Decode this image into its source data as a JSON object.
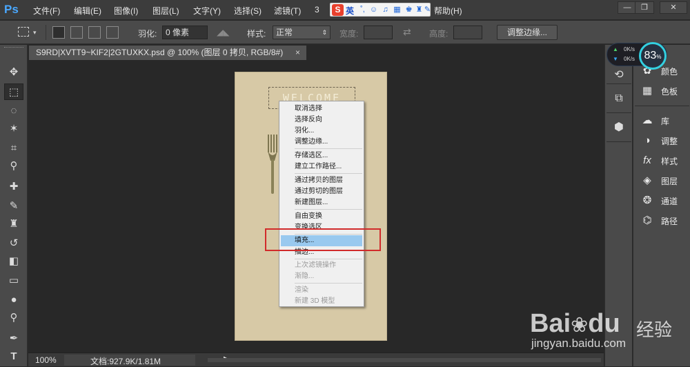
{
  "menubar": {
    "logo": "Ps",
    "items": [
      "文件(F)",
      "编辑(E)",
      "图像(I)",
      "图层(L)",
      "文字(Y)",
      "选择(S)",
      "滤镜(T)",
      "3",
      "帮助(H)"
    ],
    "ime": {
      "logo": "S",
      "lang": "英"
    }
  },
  "options": {
    "feather_label": "羽化:",
    "feather_value": "0 像素",
    "style_label": "样式:",
    "style_value": "正常",
    "width_label": "宽度:",
    "height_label": "高度:",
    "refine_edge": "调整边缘..."
  },
  "document_tab": {
    "title": "S9RD|XVTT9~KIF2|2GTUXKX.psd @ 100% (图层 0 拷贝, RGB/8#)",
    "close": "×"
  },
  "canvas": {
    "welcome_text": "WELCOME",
    "bg_color": "#d7c9a6"
  },
  "context_menu": {
    "items": [
      {
        "label": "取消选择",
        "disabled": false
      },
      {
        "label": "选择反向",
        "disabled": false
      },
      {
        "label": "羽化...",
        "disabled": false
      },
      {
        "label": "调整边缘...",
        "disabled": false
      },
      {
        "label": "存储选区...",
        "disabled": false
      },
      {
        "label": "建立工作路径...",
        "disabled": false
      },
      {
        "label": "通过拷贝的图层",
        "disabled": false
      },
      {
        "label": "通过剪切的图层",
        "disabled": false
      },
      {
        "label": "新建图层...",
        "disabled": false
      },
      {
        "label": "自由变换",
        "disabled": false
      },
      {
        "label": "变换选区",
        "disabled": false
      },
      {
        "label": "填充...",
        "disabled": false,
        "highlighted": true
      },
      {
        "label": "描边...",
        "disabled": false
      },
      {
        "label": "上次滤镜操作",
        "disabled": true
      },
      {
        "label": "渐隐...",
        "disabled": true
      },
      {
        "label": "渲染",
        "disabled": true
      },
      {
        "label": "新建 3D 模型",
        "disabled": true
      }
    ]
  },
  "statusbar": {
    "zoom": "100%",
    "doc_size": "文档:927.9K/1.81M",
    "arrow": "▶"
  },
  "panels": [
    {
      "icon": "palette-icon",
      "label": "颜色"
    },
    {
      "icon": "swatches-icon",
      "label": "色板"
    },
    {
      "icon": "library-icon",
      "label": "库"
    },
    {
      "icon": "adjustments-icon",
      "label": "调整"
    },
    {
      "icon": "styles-icon",
      "label": "样式"
    },
    {
      "icon": "layers-icon",
      "label": "图层"
    },
    {
      "icon": "channels-icon",
      "label": "通道"
    },
    {
      "icon": "paths-icon",
      "label": "路径"
    }
  ],
  "net_widget": {
    "up": "0K/s",
    "down": "0K/s",
    "cpu": "83",
    "cpu_unit": "%"
  },
  "watermark": {
    "brand": "Bai",
    "brand2": "du",
    "cn": "经验",
    "url": "jingyan.baidu.com"
  },
  "colors": {
    "accent": "#99c9ef",
    "highlight_box": "#d12a2a",
    "ps_blue": "#4aa8ff"
  }
}
